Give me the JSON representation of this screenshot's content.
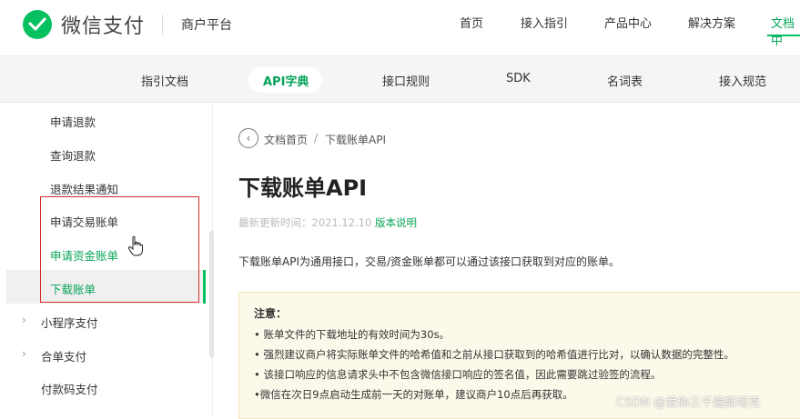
{
  "header": {
    "logo_text": "微信支付",
    "platform": "商户平台",
    "nav": [
      "首页",
      "接入指引",
      "产品中心",
      "解决方案",
      "文档中"
    ]
  },
  "subnav": {
    "tabs": [
      "指引文档",
      "API字典",
      "接口规则",
      "SDK",
      "名词表",
      "接入规范"
    ],
    "active": "API字典"
  },
  "sidebar": {
    "items": [
      "申请退款",
      "查询退款",
      "退款结果通知",
      "申请交易账单",
      "申请资金账单",
      "下载账单"
    ],
    "parents": [
      "小程序支付",
      "合单支付"
    ],
    "bottom_item": "付款码支付",
    "selected": "下载账单"
  },
  "breadcrumb": {
    "home": "文档首页",
    "separator": "/",
    "current": "下载账单API"
  },
  "page": {
    "title": "下载账单API",
    "updated_label": "最新更新时间：2021.12.10",
    "version_link": "版本说明",
    "intro": "下载账单API为通用接口，交易/资金账单都可以通过该接口获取到对应的账单。"
  },
  "notice": {
    "title": "注意：",
    "lines": [
      "• 账单文件的下载地址的有效时间为30s。",
      "• 强烈建议商户将实际账单文件的哈希值和之前从接口获取到的哈希值进行比对，以确认数据的完整性。",
      "• 该接口响应的信息请求头中不包含微信接口响应的签名值，因此需要跳过验签的流程。",
      "•微信在次日9点启动生成前一天的对账单，建议商户10点后再获取。"
    ]
  },
  "watermark": "CSDN @爱你三千遍斯塔克",
  "colors": {
    "accent": "#07c160",
    "highlight": "#d92c2c"
  },
  "icons": [
    "wechat-pay-logo-icon",
    "back-arrow-icon",
    "chevron-right-icon",
    "hand-cursor-icon"
  ]
}
